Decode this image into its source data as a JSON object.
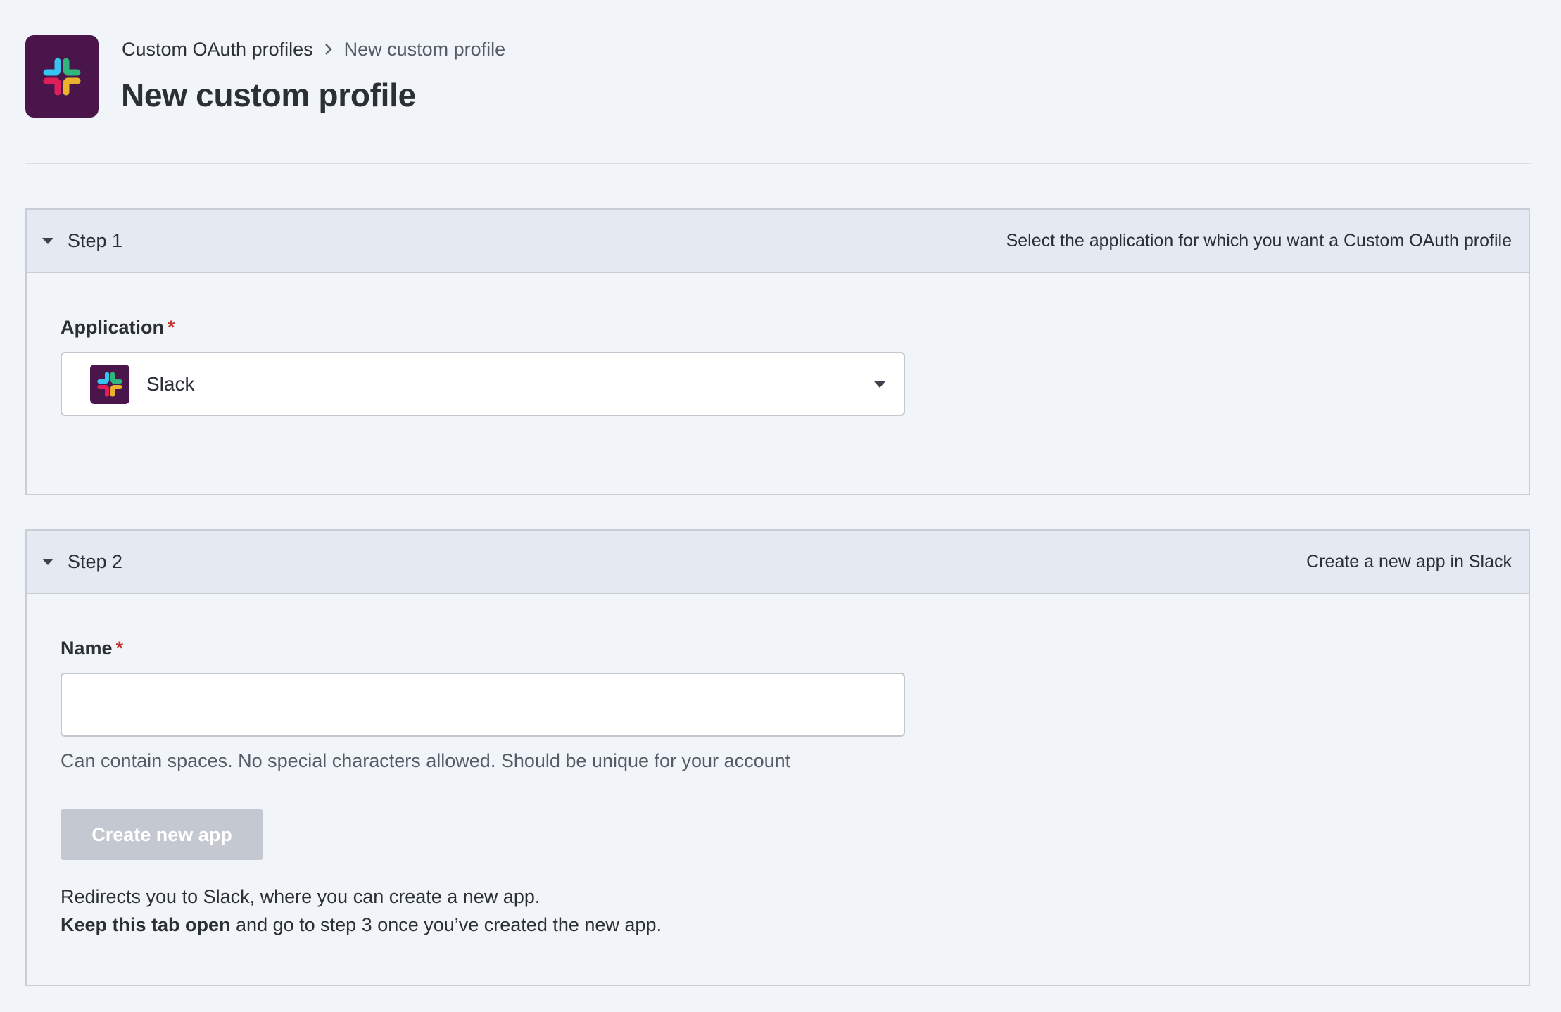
{
  "header": {
    "app_logo_icon": "slack-logo-icon",
    "breadcrumb": {
      "parent_label": "Custom OAuth profiles",
      "separator_icon": "chevron-right-icon",
      "current_label": "New custom profile"
    },
    "title": "New custom profile"
  },
  "steps": [
    {
      "title": "Step 1",
      "description": "Select the application for which you want a Custom OAuth profile",
      "expanded": true,
      "application_field": {
        "label": "Application",
        "required_mark": "*",
        "selected_value": "Slack",
        "selected_icon": "slack-logo-icon"
      }
    },
    {
      "title": "Step 2",
      "description": "Create a new app in Slack",
      "expanded": true,
      "name_field": {
        "label": "Name",
        "required_mark": "*",
        "value": "",
        "help_text": "Can contain spaces. No special characters allowed. Should be unique for your account"
      },
      "create_button_label": "Create new app",
      "note_line1": "Redirects you to Slack, where you can create a new app.",
      "note_line2_bold": "Keep this tab open",
      "note_line2_rest": " and go to step 3 once you’ve created the new app."
    }
  ],
  "colors": {
    "background": "#f1f4f9",
    "slack_brand": "#4a154b",
    "required": "#c2332a",
    "disabled_button": "#c4c8d0"
  }
}
